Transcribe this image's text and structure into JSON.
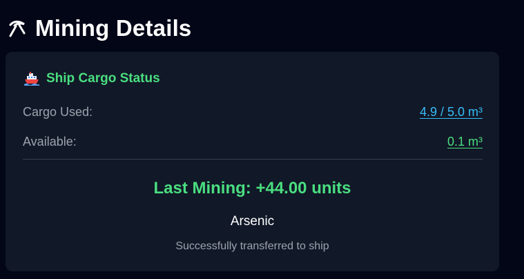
{
  "header": {
    "icon": "pickaxe-icon",
    "title": "Mining Details"
  },
  "cargo_card": {
    "icon": "ship-icon",
    "title": "Ship Cargo Status",
    "cargo_used": {
      "label": "Cargo Used:",
      "value": "4.9 / 5.0 m³"
    },
    "available": {
      "label": "Available:",
      "value": "0.1 m³"
    },
    "last_mining": "Last Mining: +44.00 units",
    "mineral": "Arsenic",
    "transfer_status": "Successfully transferred to ship"
  },
  "colors": {
    "background": "#020617",
    "card": "#111827",
    "accent_green": "#4ade80",
    "link_blue": "#38bdf8",
    "muted_text": "#9ca3af"
  }
}
